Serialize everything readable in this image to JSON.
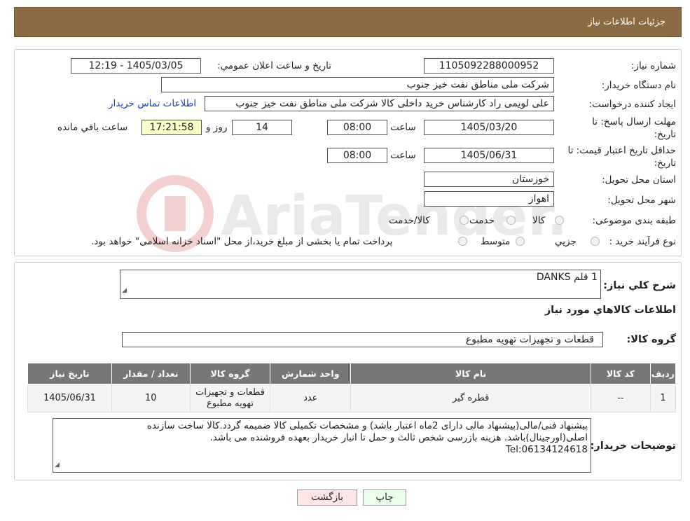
{
  "header": {
    "title": "جزئیات اطلاعات نیاز"
  },
  "form": {
    "need_number_label": "شماره نیاز:",
    "need_number": "1105092288000952",
    "announce_label": "تاریخ و ساعت اعلان عمومي:",
    "announce_value": "1405/03/05 - 12:19",
    "buyer_label": "نام دستگاه خريدار:",
    "buyer_value": "شرکت ملی مناطق نفت خیز جنوب",
    "creator_label": "ايجاد کننده درخواست:",
    "creator_value": "علی  لویمی راد  کارشناس خرید داخلی کالا شرکت ملی مناطق نفت خیز جنوب",
    "contact_link": "اطلاعات تماس خريدار",
    "deadline_label_1": "مهلت ارسال پاسخ: تا",
    "deadline_label_2": "تاريخ:",
    "deadline_date": "1405/03/20",
    "time_label": "ساعت",
    "deadline_time": "08:00",
    "days_value": "14",
    "days_label": "روز و",
    "remaining_time": "17:21:58",
    "remaining_label": "ساعت باقي مانده",
    "validity_label_1": "حداقل تاريخ اعتبار قيمت: تا",
    "validity_label_2": "تاريخ:",
    "validity_date": "1405/06/31",
    "validity_time_label": "ساعت",
    "validity_time": "08:00",
    "province_label": "استان محل تحويل:",
    "province_value": "خوزستان",
    "city_label": "شهر محل تحويل:",
    "city_value": "اهواز",
    "category_label": "طبقه بندی موضوعی:",
    "category_options": [
      "کالا",
      "خدمت",
      "کالا/خدمت"
    ],
    "process_label": "نوع فرآيند خريد :",
    "process_options": [
      "جزيي",
      "متوسط"
    ],
    "process_note": "پرداخت تمام يا بخشی از مبلغ خريد،از محل \"اسناد خزانه اسلامی\" خواهد بود."
  },
  "summary": {
    "desc_label": "شرح کلي نياز:",
    "desc_value": "1 قلم DANKS",
    "goods_info_title": "اطلاعات کالاهاي مورد نياز",
    "group_label": "گروه کالا:",
    "group_value": "قطعات و تجهیزات تهویه مطبوع"
  },
  "table": {
    "headers": [
      "رديف",
      "کد کالا",
      "نام کالا",
      "واحد شمارش",
      "گروه کالا",
      "تعداد / مقدار",
      "تاريخ نياز"
    ],
    "rows": [
      [
        "1",
        "--",
        "قطره گیر",
        "عدد",
        "قطعات و تجهیزات تهویه مطبوع",
        "10",
        "1405/06/31"
      ]
    ]
  },
  "notes": {
    "label": "توضيحات خريدار:",
    "line1": "پیشنهاد فنی/مالی(پیشنهاد مالی دارای 2ماه اعتبار باشد) و مشخصات تکمیلی کالا ضمیمه گردد.کالا ساخت سازنده",
    "line2": "اصلی(اورجینال)باشد. هزینه بازرسی شخص ثالث و حمل تا انبار خریدار بعهده فروشنده می باشد.",
    "line3": "Tel:06134124618"
  },
  "buttons": {
    "print": "چاپ",
    "back": "بازگشت"
  },
  "watermark": {
    "text": "AriaTender.neT"
  },
  "colors": {
    "header_bg": "#8B6A44",
    "yellow_field": "#ffffcc",
    "link": "#1a3ec9",
    "print_btn": "#eaffea",
    "back_btn": "#ffe6e6"
  }
}
